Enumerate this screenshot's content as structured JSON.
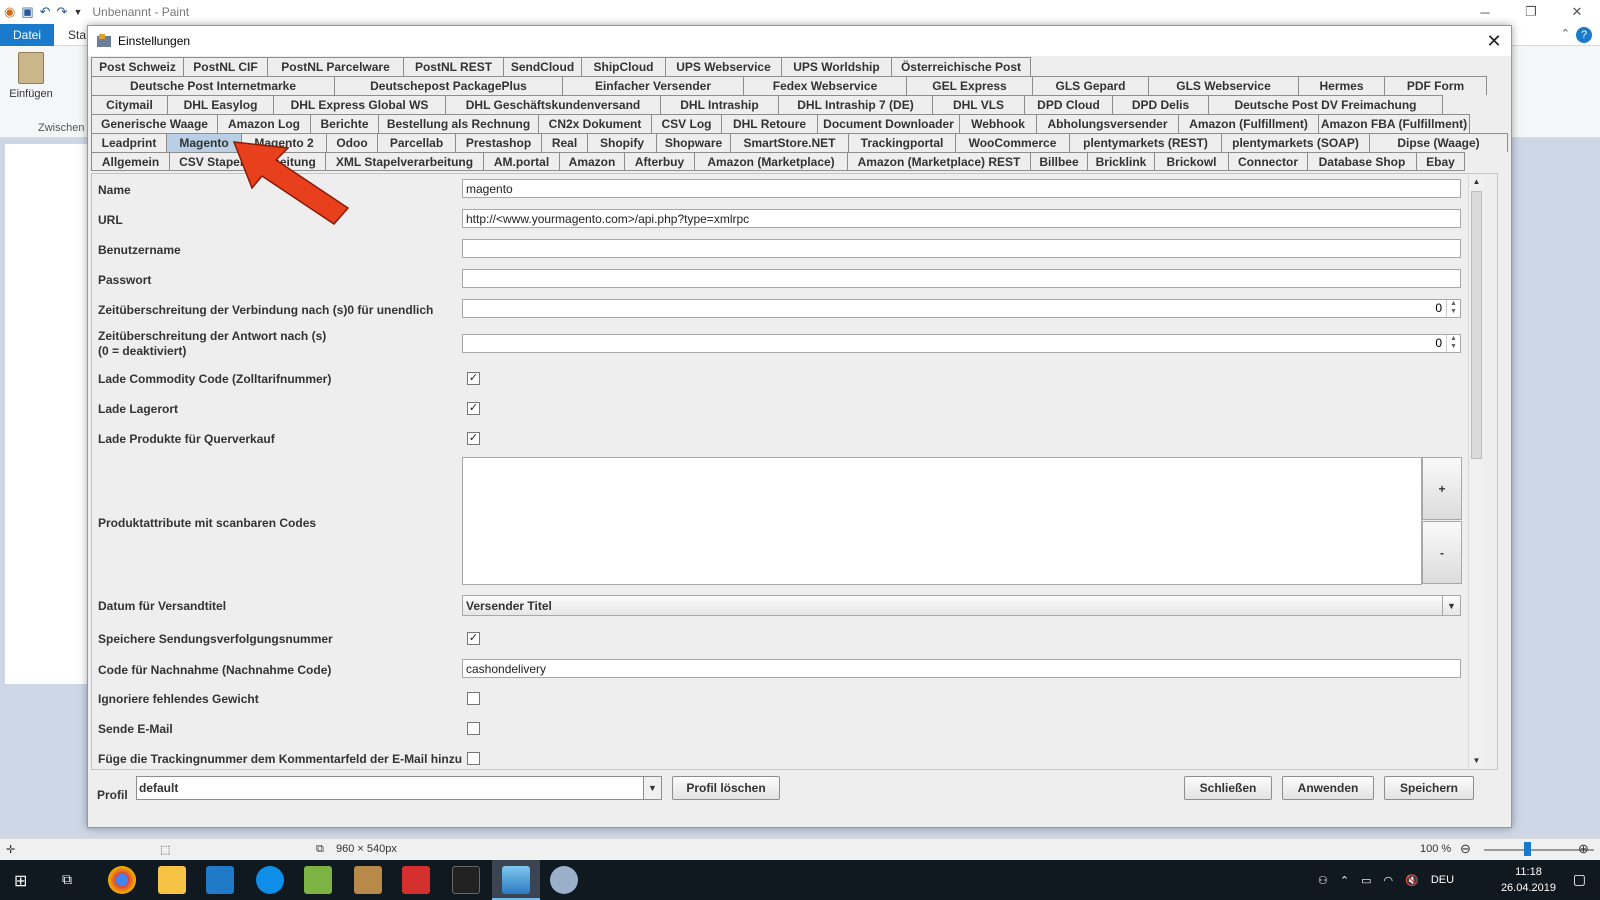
{
  "paint": {
    "window_title": "Unbenannt - Paint",
    "file_tab": "Datei",
    "start_tab": "Sta",
    "paste_label": "Einfügen",
    "clipboard_group": "Zwischen",
    "canvas_size": "960 × 540px",
    "zoom": "100 %"
  },
  "dialog": {
    "title": "Einstellungen",
    "close_glyph": "✕"
  },
  "tabs": {
    "row1": [
      "Post Schweiz",
      "PostNL CIF",
      "PostNL Parcelware",
      "PostNL REST",
      "SendCloud",
      "ShipCloud",
      "UPS Webservice",
      "UPS Worldship",
      "Österreichische Post"
    ],
    "row2": [
      "Deutsche Post Internetmarke",
      "Deutschepost PackagePlus",
      "Einfacher Versender",
      "Fedex Webservice",
      "GEL Express",
      "GLS Gepard",
      "GLS Webservice",
      "Hermes",
      "PDF Form"
    ],
    "row3": [
      "Citymail",
      "DHL Easylog",
      "DHL Express Global WS",
      "DHL Geschäftskundenversand",
      "DHL Intraship",
      "DHL Intraship 7 (DE)",
      "DHL VLS",
      "DPD Cloud",
      "DPD Delis",
      "Deutsche Post DV Freimachung"
    ],
    "row4": [
      "Generische Waage",
      "Amazon Log",
      "Berichte",
      "Bestellung als Rechnung",
      "CN2x Dokument",
      "CSV Log",
      "DHL Retoure",
      "Document Downloader",
      "Webhook",
      "Abholungsversender",
      "Amazon (Fulfillment)",
      "Amazon FBA (Fulfillment)"
    ],
    "row5": [
      "Leadprint",
      "Magento",
      "Magento 2",
      "Odoo",
      "Parcellab",
      "Prestashop",
      "Real",
      "Shopify",
      "Shopware",
      "SmartStore.NET",
      "Trackingportal",
      "WooCommerce",
      "plentymarkets (REST)",
      "plentymarkets (SOAP)",
      "Dipse (Waage)"
    ],
    "row6": [
      "Allgemein",
      "CSV Stapelverarbeitung",
      "XML Stapelverarbeitung",
      "AM.portal",
      "Amazon",
      "Afterbuy",
      "Amazon (Marketplace)",
      "Amazon (Marketplace) REST",
      "Billbee",
      "Bricklink",
      "Brickowl",
      "Connector",
      "Database Shop",
      "Ebay"
    ],
    "selected": "Magento"
  },
  "form": {
    "name_label": "Name",
    "name_value": "magento",
    "url_label": "URL",
    "url_value": "http://<www.yourmagento.com>/api.php?type=xmlrpc",
    "user_label": "Benutzername",
    "user_value": "",
    "password_label": "Passwort",
    "password_value": "",
    "conn_timeout_label": "Zeitüberschreitung der Verbindung nach (s)0 für unendlich",
    "conn_timeout_value": "0",
    "resp_timeout_label_1": "Zeitüberschreitung der Antwort nach (s)",
    "resp_timeout_label_2": "(0 = deaktiviert)",
    "resp_timeout_value": "0",
    "commodity_label": "Lade Commodity Code (Zolltarifnummer)",
    "commodity_checked": true,
    "lagerort_label": "Lade Lagerort",
    "lagerort_checked": true,
    "cross_label": "Lade Produkte für Querverkauf",
    "cross_checked": true,
    "attrs_label": "Produktattribute mit scanbaren Codes",
    "add_button": "+",
    "remove_button": "-",
    "date_label": "Datum für Versandtitel",
    "date_value": "Versender Titel",
    "save_tracking_label": "Speichere Sendungsverfolgungsnummer",
    "save_tracking_checked": true,
    "cod_label": "Code für Nachnahme (Nachnahme Code)",
    "cod_value": "cashondelivery",
    "ignore_weight_label": "Ignoriere fehlendes Gewicht",
    "ignore_weight_checked": false,
    "send_mail_label": "Sende E-Mail",
    "send_mail_checked": false,
    "comment_label": "Füge die Trackingnummer dem Kommentarfeld der E-Mail hinzu",
    "comment_checked": false
  },
  "footer": {
    "profile_label": "Profil",
    "profile_value": "default",
    "delete_profile": "Profil löschen",
    "close": "Schließen",
    "apply": "Anwenden",
    "save": "Speichern"
  },
  "taskbar": {
    "lang": "DEU",
    "time": "11:18",
    "date": "26.04.2019"
  },
  "colors": {
    "selected_tab": "#b8cfe5",
    "annotation_arrow": "#e8401c",
    "paint_file_tab": "#1979ca"
  }
}
